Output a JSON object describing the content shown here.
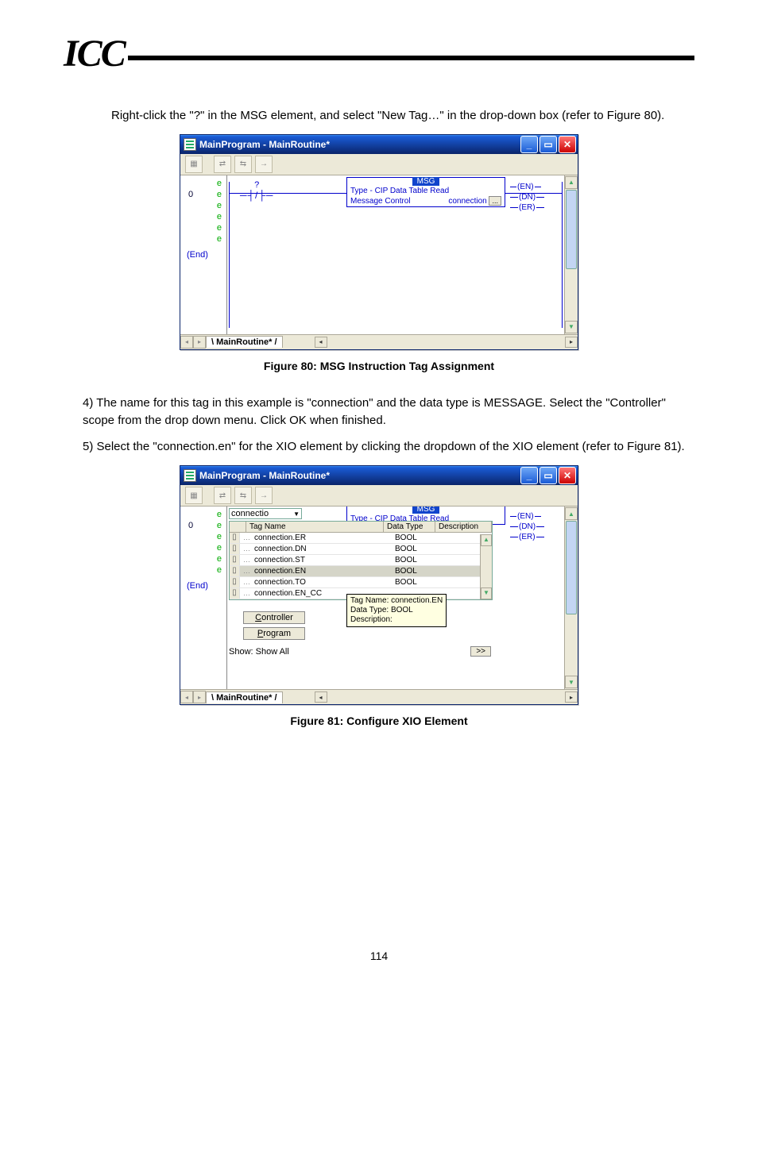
{
  "logo": "ICC",
  "para1": "Right-click the \"?\" in the MSG element, and select \"New Tag…\" in the drop-down box (refer to Figure 80).",
  "window": {
    "title": "MainProgram - MainRoutine*",
    "tab": "MainRoutine*",
    "rung_num": "0",
    "rung_e": "e",
    "rung_end": "(End)",
    "xio_q": "?",
    "xio_sym": "─┤/├─",
    "msg_label": "MSG",
    "msg_type_label": "Type - CIP Data Table Read",
    "msg_ctrl_label": "Message Control",
    "msg_ctrl_value": "connection",
    "msg_ell": "...",
    "out_en": "(EN)",
    "out_dn": "(DN)",
    "out_er": "(ER)"
  },
  "fig1_caption": "Figure 80: MSG Instruction Tag Assignment",
  "para2": "4) The name for this tag in this example is \"connection\" and the data type is MESSAGE. Select the \"Controller\" scope from the drop down menu. Click OK when finished.",
  "para3": "5) Select the \"connection.en\" for the XIO element by clicking the dropdown of the XIO element (refer to Figure 81).",
  "fig2": {
    "dd_value": "connectio",
    "head_name": "Tag Name",
    "head_type": "Data Type",
    "head_desc": "Description",
    "rows": [
      {
        "name": "connection.ER",
        "type": "BOOL",
        "sel": false
      },
      {
        "name": "connection.DN",
        "type": "BOOL",
        "sel": false
      },
      {
        "name": "connection.ST",
        "type": "BOOL",
        "sel": false
      },
      {
        "name": "connection.EN",
        "type": "BOOL",
        "sel": true
      },
      {
        "name": "connection.TO",
        "type": "BOOL",
        "sel": false
      },
      {
        "name": "connection.EN_CC",
        "type": "",
        "sel": false
      }
    ],
    "tooltip_l1": "Tag Name: connection.EN",
    "tooltip_l2": "Data Type: BOOL",
    "tooltip_l3": "Description:",
    "btn_controller": "Controller",
    "btn_program": "Program",
    "show_label": "Show: Show All",
    "more": ">>"
  },
  "fig2_caption": "Figure 81: Configure XIO Element",
  "page_num": "114"
}
